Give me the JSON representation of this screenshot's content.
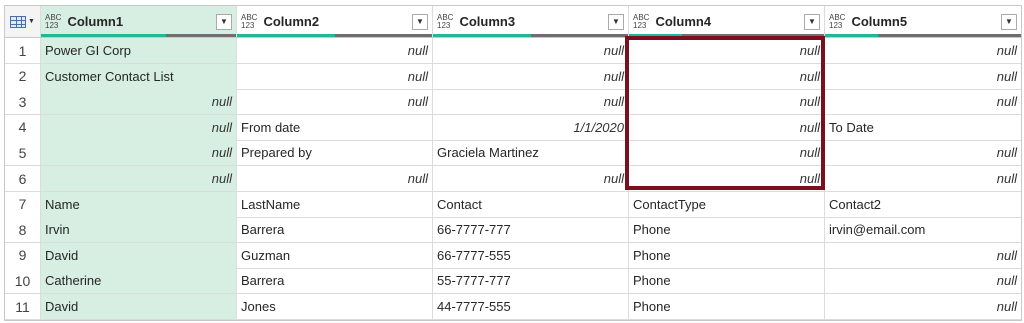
{
  "columns": [
    {
      "name": "Column1",
      "type_top": "ABC",
      "type_bottom": "123"
    },
    {
      "name": "Column2",
      "type_top": "ABC",
      "type_bottom": "123"
    },
    {
      "name": "Column3",
      "type_top": "ABC",
      "type_bottom": "123"
    },
    {
      "name": "Column4",
      "type_top": "ABC",
      "type_bottom": "123"
    },
    {
      "name": "Column5",
      "type_top": "ABC",
      "type_bottom": "123"
    }
  ],
  "column_quality": [
    {
      "valid": 0.64,
      "error": 0.36
    },
    {
      "valid": 0.5,
      "error": 0.5
    },
    {
      "valid": 0.5,
      "error": 0.5
    },
    {
      "valid": 0.27,
      "error": 0.73
    },
    {
      "valid": 0.27,
      "error": 0.73
    }
  ],
  "rows": [
    {
      "n": "1",
      "cells": [
        "Power GI Corp",
        "null",
        "null",
        "null",
        "null"
      ]
    },
    {
      "n": "2",
      "cells": [
        "Customer Contact List",
        "null",
        "null",
        "null",
        "null"
      ]
    },
    {
      "n": "3",
      "cells": [
        "null",
        "null",
        "null",
        "null",
        "null"
      ]
    },
    {
      "n": "4",
      "cells": [
        "null",
        "From date",
        "1/1/2020",
        "null",
        "To Date"
      ]
    },
    {
      "n": "5",
      "cells": [
        "null",
        "Prepared by",
        "Graciela Martinez",
        "null",
        "null"
      ]
    },
    {
      "n": "6",
      "cells": [
        "null",
        "null",
        "null",
        "null",
        "null"
      ]
    },
    {
      "n": "7",
      "cells": [
        "Name",
        "LastName",
        "Contact",
        "ContactType",
        "Contact2"
      ]
    },
    {
      "n": "8",
      "cells": [
        "Irvin",
        "Barrera",
        "66-7777-777",
        "Phone",
        "irvin@email.com"
      ]
    },
    {
      "n": "9",
      "cells": [
        "David",
        "Guzman",
        "66-7777-555",
        "Phone",
        "null"
      ]
    },
    {
      "n": "10",
      "cells": [
        "Catherine",
        "Barrera",
        "55-7777-777",
        "Phone",
        "null"
      ]
    },
    {
      "n": "11",
      "cells": [
        "David",
        "Jones",
        "44-7777-555",
        "Phone",
        "null"
      ]
    }
  ],
  "right_aligned_values": [
    "null",
    "1/1/2020"
  ],
  "colors": {
    "selected_column_bg": "#d7eee3",
    "quality_valid": "#1fb89a",
    "quality_error": "#6f6f6f",
    "highlight_border": "#7b0f1d"
  }
}
